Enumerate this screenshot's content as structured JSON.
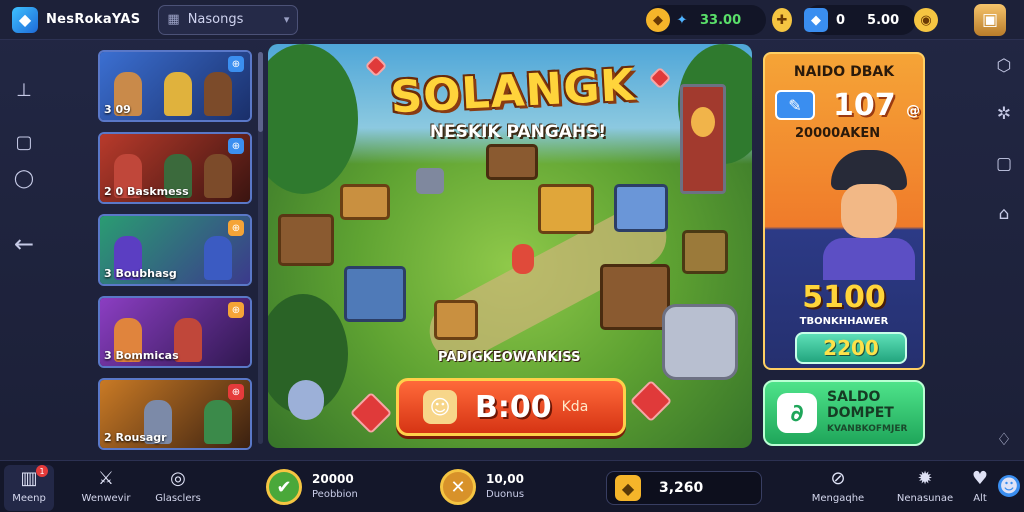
{
  "app": {
    "title": "NesRokaYAS",
    "logo_icon": "app-logo-icon"
  },
  "header": {
    "tab_label": "Nasongs",
    "resources": [
      {
        "name": "crystal",
        "value": "33.00",
        "icon": "crystal-icon",
        "color": "#f5b52a"
      },
      {
        "name": "energy",
        "value": "0",
        "icon": "energy-icon",
        "color": "#3a8ef0"
      },
      {
        "name": "coins",
        "value": "5.00",
        "icon": "coin-icon",
        "color": "#f5c542"
      }
    ],
    "bag_icon": "backpack-icon"
  },
  "game_list": [
    {
      "label": "3 09",
      "badge": "⊕",
      "bg": "#3b6fd1"
    },
    {
      "label": "2 0 Baskmess",
      "badge": "⊕",
      "bg": "#b83a2b"
    },
    {
      "label": "3 Boubhasg",
      "badge": "⊕",
      "bg": "#2a9c72"
    },
    {
      "label": "3 Bommicas",
      "badge": "⊕",
      "bg": "#8b3ec2"
    },
    {
      "label": "2 Rousagr",
      "badge": "⊕",
      "bg": "#c97a25"
    }
  ],
  "scene": {
    "title": "SOLANGK",
    "subtitle": "NESKIK PANGAHS!",
    "caption": "PADIGKEOWANKISS",
    "play_value": "B:00",
    "play_unit": "Kda"
  },
  "promo": {
    "title": "NAIDO DBAK",
    "big_value": "107",
    "big_suffix": "@",
    "sub": "20000AKEN",
    "price": "5100",
    "caption": "TBONKHHAWER",
    "button_value": "2200"
  },
  "wallet": {
    "line1": "SALDO",
    "line2": "DOMPET",
    "line3": "KVANBKOFMJER",
    "icon": "wallet-icon"
  },
  "bottom_nav": {
    "left": [
      {
        "label": "Meenp",
        "icon": "home-icon",
        "active": true,
        "badge": "1"
      },
      {
        "label": "Wenwevir",
        "icon": "sword-icon",
        "active": false
      },
      {
        "label": "Glasclers",
        "icon": "gem-icon",
        "active": false
      }
    ],
    "stats": [
      {
        "value": "20000",
        "label": "Peobbion",
        "icon": "trophy-icon",
        "color": "#4aa83a"
      },
      {
        "value": "10,00",
        "label": "Duonus",
        "icon": "sword-cross-icon",
        "color": "#d8922a"
      }
    ],
    "coin_value": "3,260",
    "right": [
      {
        "label": "Mengaqhe",
        "icon": "compass-icon"
      },
      {
        "label": "Nenasunae",
        "icon": "puzzle-icon"
      },
      {
        "label": "Alt",
        "icon": "heart-icon"
      }
    ]
  }
}
